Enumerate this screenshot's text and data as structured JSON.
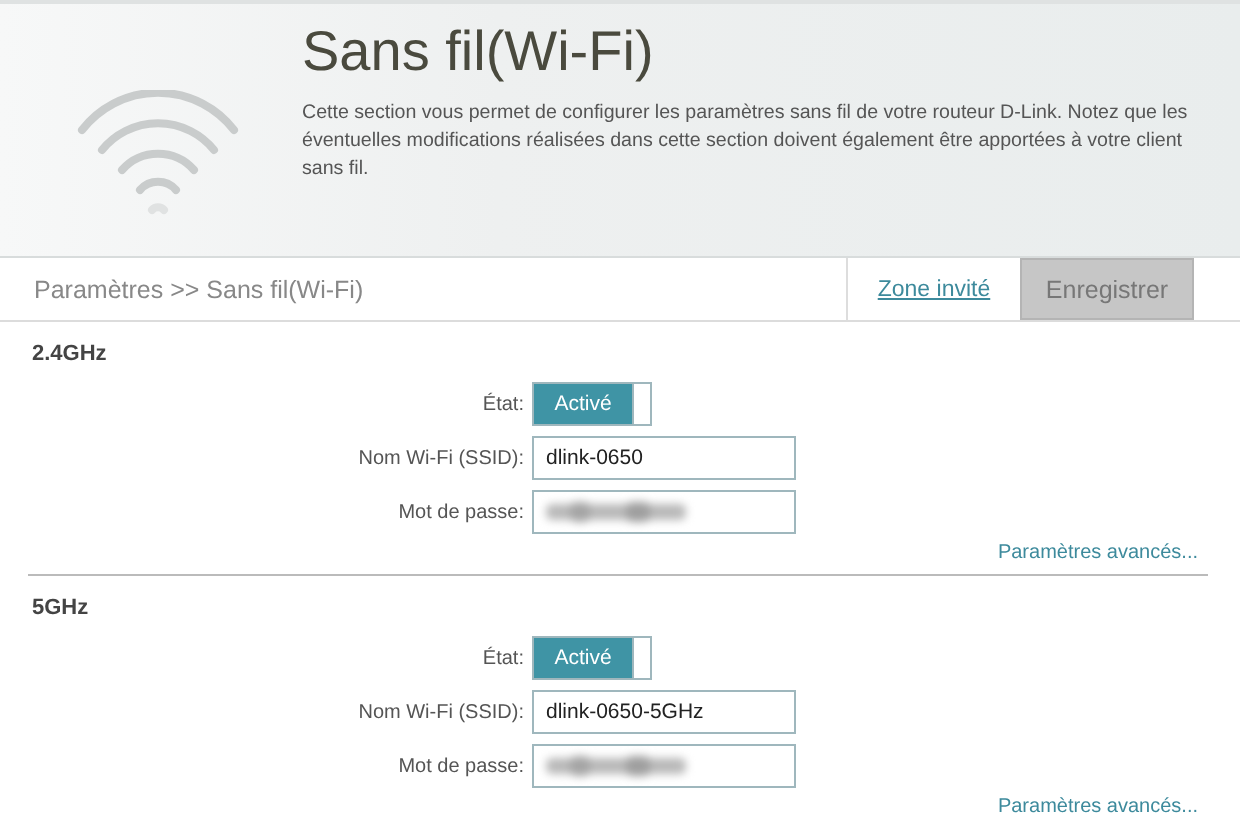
{
  "header": {
    "title": "Sans fil(Wi-Fi)",
    "description": "Cette section vous permet de configurer les paramètres sans fil de votre routeur D-Link. Notez que les éventuelles modifications réalisées dans cette section doivent également être apportées à votre client sans fil."
  },
  "toolbar": {
    "breadcrumb": "Paramètres >> Sans fil(Wi-Fi)",
    "guest_link": "Zone invité",
    "save_button": {
      "label": "Enregistrer",
      "disabled": true
    }
  },
  "bands": [
    {
      "title": "2.4GHz",
      "state_label": "État:",
      "state": {
        "label": "Activé",
        "on": true
      },
      "ssid_label": "Nom Wi-Fi (SSID):",
      "ssid": "dlink-0650",
      "password_label": "Mot de passe:",
      "advanced_link": "Paramètres avancés..."
    },
    {
      "title": "5GHz",
      "state_label": "État:",
      "state": {
        "label": "Activé",
        "on": true
      },
      "ssid_label": "Nom Wi-Fi (SSID):",
      "ssid": "dlink-0650-5GHz",
      "password_label": "Mot de passe:",
      "advanced_link": "Paramètres avancés..."
    }
  ]
}
